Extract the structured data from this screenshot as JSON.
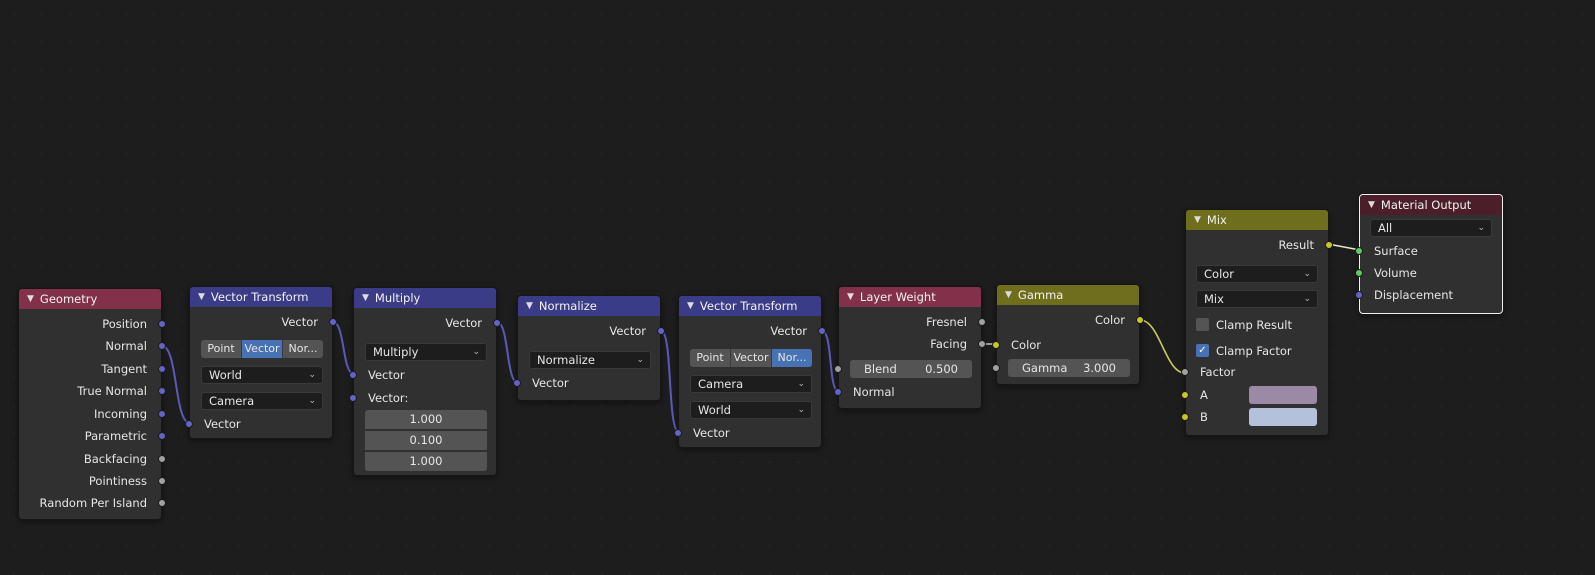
{
  "colors": {
    "vector_socket": "#6363c7",
    "float_socket": "#a1a1a1",
    "color_socket": "#c7c729",
    "shader_socket": "#63c763",
    "active_button": "#4772b3",
    "swatch_a": "#9a8aa5",
    "swatch_b": "#b3c2da"
  },
  "nodes": {
    "geometry": {
      "title": "Geometry",
      "outputs": [
        "Position",
        "Normal",
        "Tangent",
        "True Normal",
        "Incoming",
        "Parametric",
        "Backfacing",
        "Pointiness",
        "Random Per Island"
      ]
    },
    "vt1": {
      "title": "Vector Transform",
      "out": "Vector",
      "seg": [
        "Point",
        "Vector",
        "Nor..."
      ],
      "from": "World",
      "to": "Camera",
      "in": "Vector"
    },
    "multiply": {
      "title": "Multiply",
      "out": "Vector",
      "op": "Multiply",
      "in1": "Vector",
      "in2": "Vector:",
      "values": [
        "1.000",
        "0.100",
        "1.000"
      ]
    },
    "normalize": {
      "title": "Normalize",
      "out": "Vector",
      "op": "Normalize",
      "in": "Vector"
    },
    "vt2": {
      "title": "Vector Transform",
      "out": "Vector",
      "seg": [
        "Point",
        "Vector",
        "Nor..."
      ],
      "from": "Camera",
      "to": "World",
      "in": "Vector"
    },
    "layer_weight": {
      "title": "Layer Weight",
      "out1": "Fresnel",
      "out2": "Facing",
      "blend_label": "Blend",
      "blend_value": "0.500",
      "in": "Normal"
    },
    "gamma": {
      "title": "Gamma",
      "out": "Color",
      "in": "Color",
      "gamma_label": "Gamma",
      "gamma_value": "3.000"
    },
    "mix": {
      "title": "Mix",
      "out": "Result",
      "data_type": "Color",
      "blend": "Mix",
      "clamp_result": "Clamp Result",
      "clamp_factor": "Clamp Factor",
      "factor": "Factor",
      "a": "A",
      "b": "B"
    },
    "material_output": {
      "title": "Material Output",
      "target": "All",
      "inputs": [
        "Surface",
        "Volume",
        "Displacement"
      ]
    }
  }
}
